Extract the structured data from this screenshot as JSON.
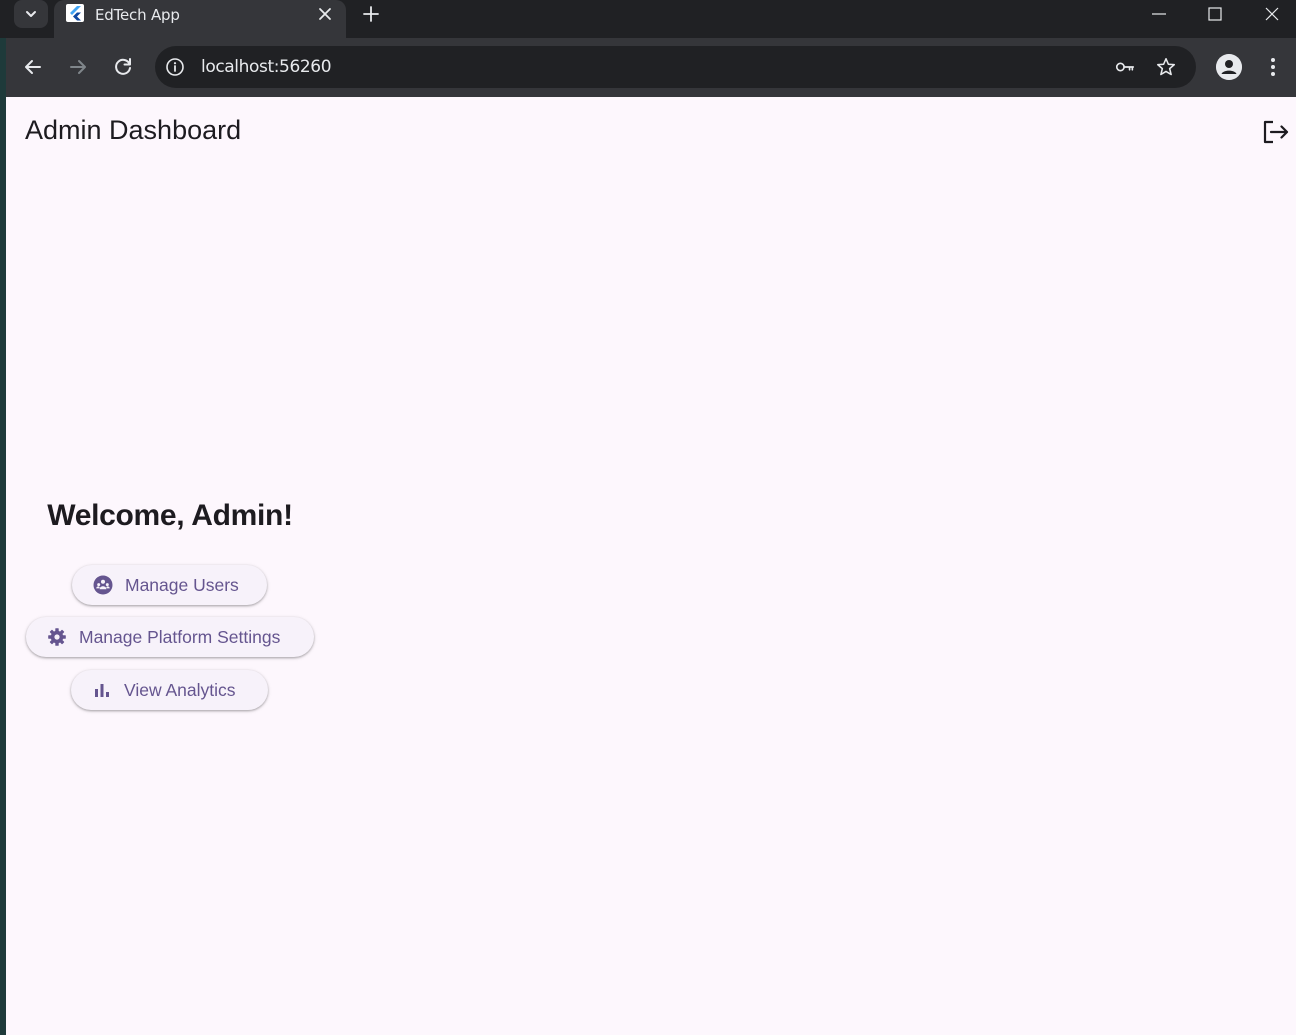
{
  "browser": {
    "tab": {
      "title": "EdTech App"
    },
    "address_bar": {
      "url": "localhost:56260"
    }
  },
  "app": {
    "title": "Admin Dashboard",
    "welcome": "Welcome, Admin!",
    "actions": [
      {
        "label": "Manage Users",
        "icon": "group-icon"
      },
      {
        "label": "Manage Platform Settings",
        "icon": "gear-icon"
      },
      {
        "label": "View Analytics",
        "icon": "bar-chart-icon"
      }
    ]
  },
  "colors": {
    "background": "#fdf7fd",
    "button_bg": "#f7f2fa",
    "accent": "#65558f",
    "text": "#1d1b20",
    "chrome_dark": "#202124",
    "chrome_toolbar": "#35363a"
  }
}
